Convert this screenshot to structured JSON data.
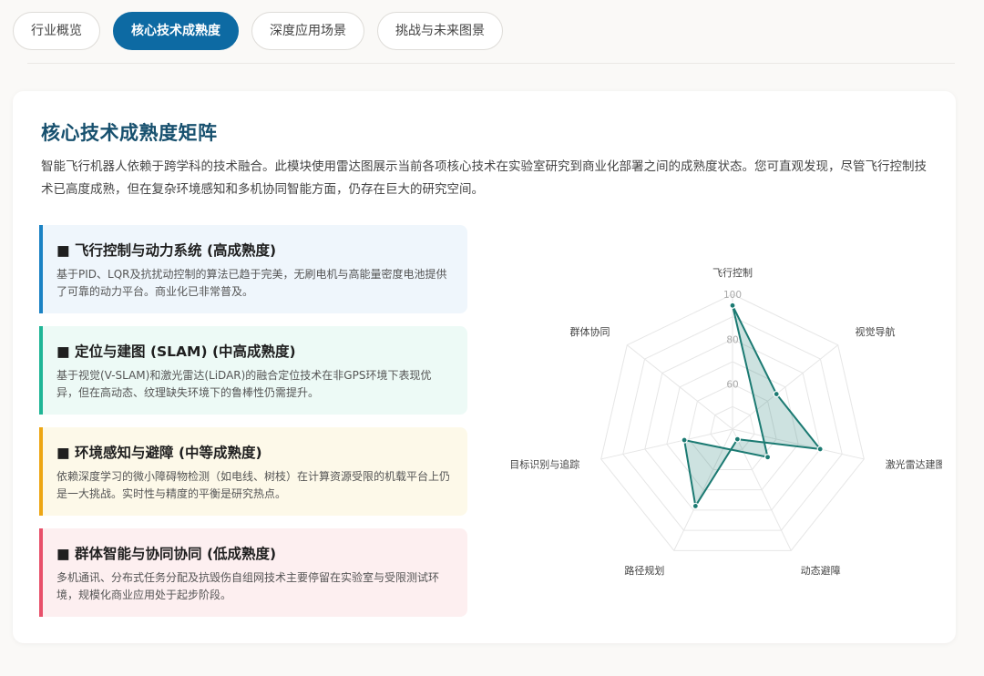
{
  "tabs": [
    {
      "label": "行业概览",
      "active": false
    },
    {
      "label": "核心技术成熟度",
      "active": true
    },
    {
      "label": "深度应用场景",
      "active": false
    },
    {
      "label": "挑战与未来图景",
      "active": false
    }
  ],
  "section": {
    "title": "核心技术成熟度矩阵",
    "description": "智能飞行机器人依赖于跨学科的技术融合。此模块使用雷达图展示当前各项核心技术在实验室研究到商业化部署之间的成熟度状态。您可直观发现，尽管飞行控制技术已高度成熟，但在复杂环境感知和多机协同智能方面，仍存在巨大的研究空间。"
  },
  "tech_items": [
    {
      "title": "■ 飞行控制与动力系统 (高成熟度)",
      "description": "基于PID、LQR及抗扰动控制的算法已趋于完美，无刷电机与高能量密度电池提供了可靠的动力平台。商业化已非常普及。",
      "color": "#1a82c4",
      "bg": "#eff6fc"
    },
    {
      "title": "■ 定位与建图 (SLAM) (中高成熟度)",
      "description": "基于视觉(V-SLAM)和激光雷达(LiDAR)的融合定位技术在非GPS环境下表现优异，但在高动态、纹理缺失环境下的鲁棒性仍需提升。",
      "color": "#1fb596",
      "bg": "#edfaf6"
    },
    {
      "title": "■ 环境感知与避障 (中等成熟度)",
      "description": "依赖深度学习的微小障碍物检测（如电线、树枝）在计算资源受限的机载平台上仍是一大挑战。实时性与精度的平衡是研究热点。",
      "color": "#eda614",
      "bg": "#fdf9e9"
    },
    {
      "title": "■ 群体智能与协同协同 (低成熟度)",
      "description": "多机通讯、分布式任务分配及抗毁伤自组网技术主要停留在实验室与受限测试环境，规模化商业应用处于起步阶段。",
      "color": "#e8506a",
      "bg": "#fdeff0"
    }
  ],
  "chart_data": {
    "type": "radar",
    "categories": [
      "飞行控制",
      "视觉导航",
      "激光雷达建图",
      "动态避障",
      "路径规划",
      "目标识别与追踪",
      "群体协同"
    ],
    "values": [
      95,
      65,
      80,
      45,
      78,
      62,
      20
    ],
    "ticks": [
      60,
      80,
      100
    ],
    "rmin": 40,
    "rmax": 100,
    "colors": {
      "stroke": "#1b7a72",
      "fill": "rgba(27,122,114,0.22)",
      "grid": "#e6e6e6",
      "label": "#444",
      "tick": "#aaa"
    }
  }
}
